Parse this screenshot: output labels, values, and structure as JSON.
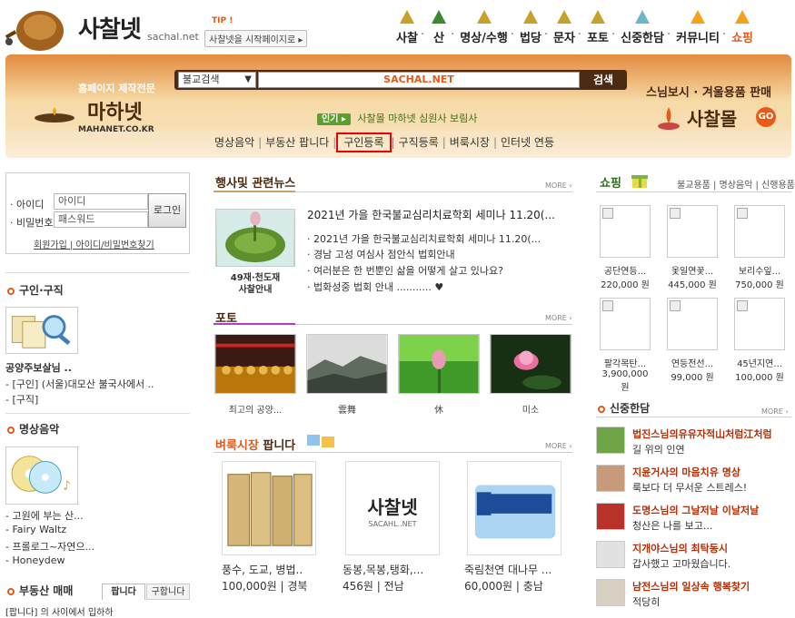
{
  "header": {
    "logo_text": "사찰넷",
    "logo_domain": "sachal.net",
    "tip_label": "TIP !",
    "start_page_label": "사찰넷을 시작페이지로",
    "nav": [
      {
        "label": "사찰",
        "icon": "temple-icon"
      },
      {
        "label": "산",
        "icon": "mountain-icon"
      },
      {
        "label": "명상/수행",
        "icon": "meditation-icon"
      },
      {
        "label": "법당",
        "icon": "hall-icon"
      },
      {
        "label": "문자",
        "icon": "message-icon"
      },
      {
        "label": "포토",
        "icon": "photo-icon"
      },
      {
        "label": "신중한담",
        "icon": "tea-icon"
      },
      {
        "label": "커뮤니티",
        "icon": "talk-icon"
      },
      {
        "label": "쇼핑",
        "icon": "gift-icon"
      }
    ]
  },
  "banner": {
    "mahanet_sub": "홈페이지 제작전문",
    "mahanet_title": "마하넷",
    "mahanet_url": "MAHANET.CO.KR",
    "search_select": "불교검색",
    "search_value": "SACHAL.NET",
    "search_button": "검색",
    "popular_badge": "인기",
    "popular_text": "사찰몰 마하넷 심원사 보림사",
    "categories": [
      "명상음악",
      "부동산 팝니다",
      "구인등록",
      "구직등록",
      "벼룩시장",
      "인터넷 연등"
    ],
    "shop_sub": "스님보시 · 겨울용품 판매",
    "shop_title": "사찰몰",
    "shop_go": "GO"
  },
  "login": {
    "id_label": "· 아이디",
    "pw_label": "· 비밀번호",
    "id_placeholder": "아이디",
    "pw_placeholder": "패스워드",
    "login_button": "로그인",
    "links": "회원가입 | 아이디/비밀번호찾기"
  },
  "left": {
    "jobs_title": "구인·구직",
    "jobs_items": [
      "공양주보살님 ..",
      "- [구인] (서울)대모산 불국사에서 ..",
      "- [구직]"
    ],
    "music_title": "명상음악",
    "music_items": [
      "- 고원에 부는 산...",
      "- Fairy Waltz",
      "- 프롤로그~자연으...",
      "- Honeydew"
    ],
    "estate_title": "부동산 매매",
    "estate_tabs": [
      "팝니다",
      "구합니다"
    ],
    "estate_item": "[팝니다] 의 사이에서 입하하"
  },
  "news": {
    "title": "행사및 관련뉴스",
    "more": "MORE",
    "image_caption": "49재·천도재 사찰안내",
    "headline": "2021년 가을 한국불교심리치료학회 세미나 11.20(...",
    "items": [
      "· 2021년 가을 한국불교심리치료학회 세미나 11.20(...",
      "· 경남 고성 여심사 점안식 법회안내",
      "· 여러분은 한 번뿐인 삶을 어떻게 살고 있나요?",
      "· 법화성중 법회 안내 ........... ♥"
    ]
  },
  "photo": {
    "title": "포토",
    "more": "MORE",
    "captions": [
      "최고의 공양...",
      "雲舞",
      "休",
      "미소"
    ]
  },
  "market": {
    "title_a": "벼룩시장",
    "title_b": "팝니다",
    "more": "MORE",
    "products": [
      {
        "name": "풍수, 도교, 병법..",
        "price": "100,000원 | 경북"
      },
      {
        "name": "동봉,목봉,탱화,...",
        "price": "456원 | 전남"
      },
      {
        "name": "죽림천연 대나무 ...",
        "price": "60,000원 | 충남"
      }
    ],
    "placeholder_logo": "사찰넷",
    "placeholder_domain": "SACAHL..NET"
  },
  "shopping": {
    "title": "쇼핑",
    "links": "불교용품 | 명상음악 | 신행용품",
    "items": [
      {
        "name": "공단연등...",
        "price": "220,000 원"
      },
      {
        "name": "옻일연꽃...",
        "price": "445,000 원"
      },
      {
        "name": "보리수잎...",
        "price": "750,000 원"
      },
      {
        "name": "팔각목탄...",
        "price": "3,900,000 원"
      },
      {
        "name": "연등전선...",
        "price": "99,000 원"
      },
      {
        "name": "45년지연...",
        "price": "100,000 원"
      }
    ]
  },
  "shinjung": {
    "title": "신중한담",
    "more": "MORE",
    "items": [
      {
        "t1": "법진스님의유유자적山처럼江처럼",
        "t2": "길 위의 인연"
      },
      {
        "t1": "지윤거사의 마음치유 명상",
        "t2": "룩보다 더 무서운 스트레스!"
      },
      {
        "t1": "도명스님의 그날저날 이날저날",
        "t2": "청산은 나를 보고..."
      },
      {
        "t1": "지개야스님의 최탁동시",
        "t2": "갑사했고 고마웠습니다."
      },
      {
        "t1": "남전스님의 일상속 행복찾기",
        "t2": "적당히"
      }
    ]
  },
  "colors": {
    "accent": "#e05a1b",
    "banner": "#e38b3f",
    "brown": "#4a2a0e"
  }
}
